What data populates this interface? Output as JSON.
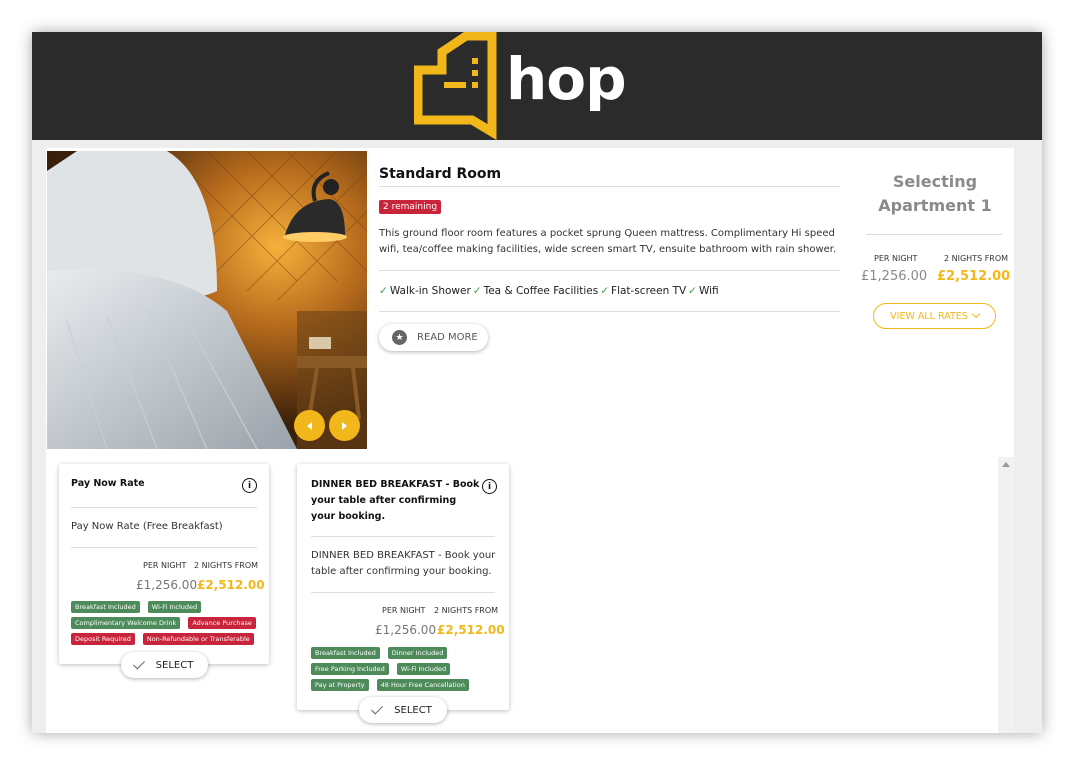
{
  "brand": {
    "name": "hop",
    "accent": "#f2b71a",
    "header_bg": "#2b2b2b"
  },
  "room": {
    "title": "Standard Room",
    "remaining": "2 remaining",
    "description": "This ground floor room features a pocket sprung Queen mattress. Complimentary Hi speed wifi, tea/coffee making facilities, wide screen smart TV, ensuite bathroom with rain shower.",
    "amenities": [
      "Walk-in Shower",
      "Tea & Coffee Facilities",
      "Flat-screen TV",
      "Wifi"
    ],
    "read_more": "READ MORE"
  },
  "selection": {
    "heading": "Selecting Apartment 1",
    "per_night_label": "PER NIGHT",
    "nights_label": "2 NIGHTS FROM",
    "price_per_night": "£1,256.00",
    "price_total": "£2,512.00",
    "view_all_rates": "VIEW ALL RATES"
  },
  "rates": [
    {
      "title": "Pay Now Rate",
      "description": "Pay Now Rate (Free Breakfast)",
      "per_night_label": "PER NIGHT",
      "nights_label": "2 NIGHTS FROM",
      "price_per_night": "£1,256.00",
      "price_total": "£2,512.00",
      "tags": [
        {
          "label": "Breakfast Included",
          "color": "green"
        },
        {
          "label": "Wi-Fi Included",
          "color": "green"
        },
        {
          "label": "Complimentary Welcome Drink",
          "color": "green"
        },
        {
          "label": "Advance Purchase",
          "color": "red"
        },
        {
          "label": "Deposit Required",
          "color": "red"
        },
        {
          "label": "Non-Refundable or Transferable",
          "color": "red"
        }
      ],
      "select_label": "SELECT"
    },
    {
      "title": "DINNER BED BREAKFAST - Book your table after confirming your booking.",
      "description": "DINNER BED BREAKFAST - Book your table after confirming your booking.",
      "per_night_label": "PER NIGHT",
      "nights_label": "2 NIGHTS FROM",
      "price_per_night": "£1,256.00",
      "price_total": "£2,512.00",
      "tags": [
        {
          "label": "Breakfast Included",
          "color": "green"
        },
        {
          "label": "Dinner Included",
          "color": "green"
        },
        {
          "label": "Free Parking Included",
          "color": "green"
        },
        {
          "label": "Wi-Fi Included",
          "color": "green"
        },
        {
          "label": "Pay at Property",
          "color": "green"
        },
        {
          "label": "48 Hour Free Cancellation",
          "color": "green"
        }
      ],
      "select_label": "SELECT"
    }
  ]
}
